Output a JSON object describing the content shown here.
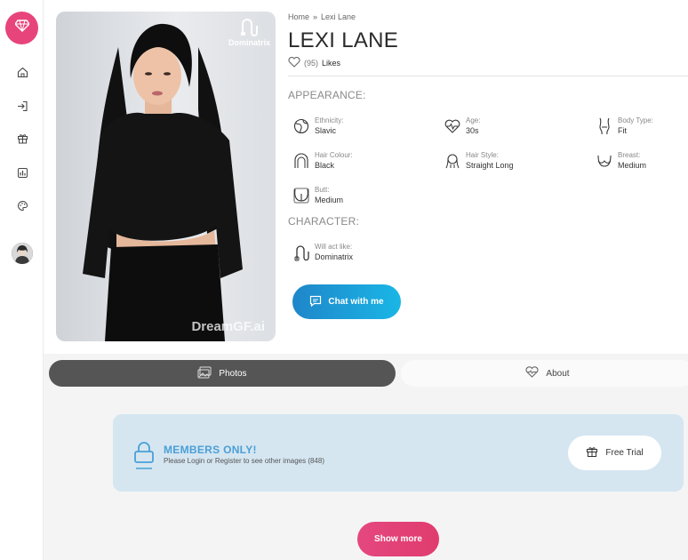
{
  "sidebar": {
    "logo": "diamond-icon",
    "items": [
      {
        "icon": "home-icon"
      },
      {
        "icon": "login-icon"
      },
      {
        "icon": "gift-icon"
      },
      {
        "icon": "chart-icon"
      },
      {
        "icon": "palette-icon"
      }
    ],
    "avatar": "user-avatar"
  },
  "profile": {
    "badge_label": "Dominatrix",
    "watermark": "DreamGF.ai",
    "breadcrumb": {
      "home": "Home",
      "separator": "»",
      "current": "Lexi Lane"
    },
    "name": "LEXI LANE",
    "likes_count": "(95)",
    "likes_label": "Likes"
  },
  "appearance": {
    "title": "APPEARANCE:",
    "ethnicity": {
      "label": "Ethnicity:",
      "value": "Slavic"
    },
    "age": {
      "label": "Age:",
      "value": "30s"
    },
    "body_type": {
      "label": "Body Type:",
      "value": "Fit"
    },
    "hair_colour": {
      "label": "Hair Colour:",
      "value": "Black"
    },
    "hair_style": {
      "label": "Hair Style:",
      "value": "Straight Long"
    },
    "breast": {
      "label": "Breast:",
      "value": "Medium"
    },
    "butt": {
      "label": "Butt:",
      "value": "Medium"
    }
  },
  "character": {
    "title": "CHARACTER:",
    "will_act_like": {
      "label": "Will act like:",
      "value": "Dominatrix"
    }
  },
  "actions": {
    "chat_label": "Chat with me",
    "show_more_label": "Show more",
    "free_trial_label": "Free Trial"
  },
  "tabs": {
    "photos": "Photos",
    "about": "About"
  },
  "members": {
    "title": "MEMBERS ONLY!",
    "subtitle": "Please Login or Register to see other images (848)"
  },
  "colors": {
    "brand_pink": "#e8447c",
    "chat_blue": "#1f86c9",
    "members_bg": "#d5e6f1",
    "members_title": "#4a9fd6"
  }
}
